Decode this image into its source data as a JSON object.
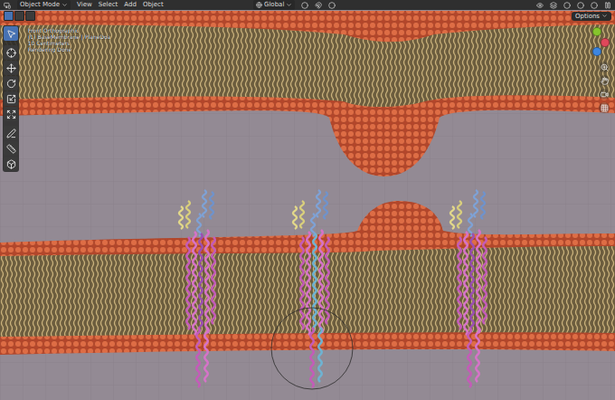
{
  "header": {
    "mode": "Object Mode",
    "menus": [
      "View",
      "Select",
      "Add",
      "Object"
    ],
    "orientation": "Global"
  },
  "select_modes": [
    {
      "selected": true
    },
    {
      "selected": false
    },
    {
      "selected": false
    }
  ],
  "options": {
    "label": "Options"
  },
  "overlay_info": [
    "Front Orthographic",
    "(1) BaseMembrane | PlaneDoa",
    "10 Centimeters",
    "Rendering Done"
  ],
  "tools": [
    {
      "kind": "select",
      "selected": true
    },
    {
      "kind": "cursor",
      "selected": false
    },
    {
      "kind": "move",
      "selected": false
    },
    {
      "kind": "rotate",
      "selected": false
    },
    {
      "kind": "scale",
      "selected": false
    },
    {
      "kind": "transform",
      "selected": false
    },
    {
      "kind": "annotate",
      "selected": false
    },
    {
      "kind": "measure",
      "selected": false
    },
    {
      "kind": "add",
      "selected": false
    }
  ],
  "navigation_gizmo": {
    "axes": [
      {
        "color": "#e0485a"
      },
      {
        "color": "#86c52c"
      },
      {
        "color": "#3d86e0"
      }
    ]
  }
}
